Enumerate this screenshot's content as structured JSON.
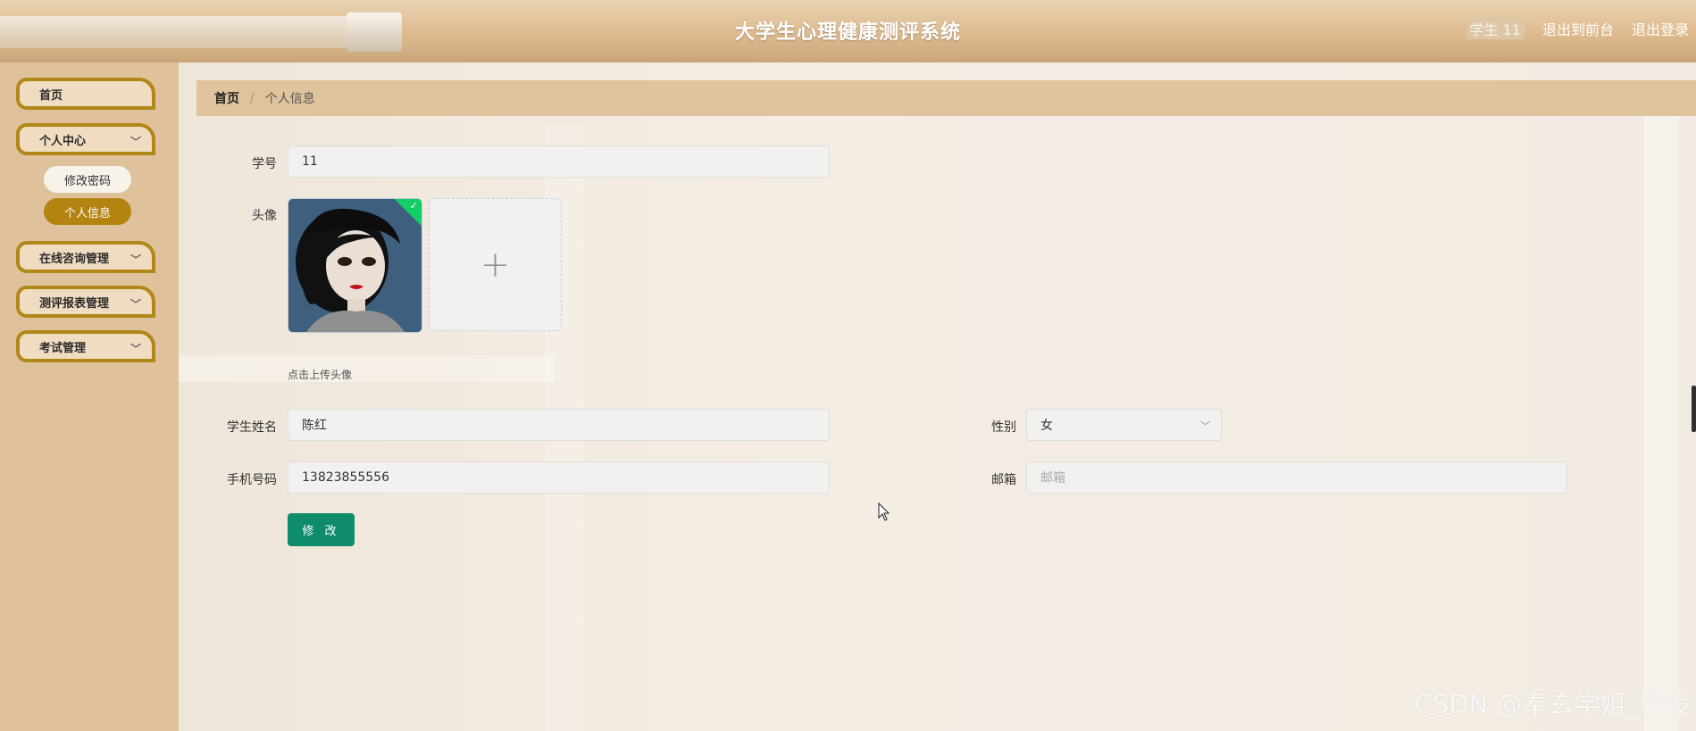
{
  "header": {
    "title": "大学生心理健康测评系统",
    "user": "学生 11",
    "to_front": "退出到前台",
    "logout": "退出登录"
  },
  "sidebar": {
    "items": [
      {
        "label": "首页",
        "has_arrow": false
      },
      {
        "label": "个人中心",
        "has_arrow": true
      },
      {
        "label": "在线咨询管理",
        "has_arrow": true
      },
      {
        "label": "测评报表管理",
        "has_arrow": true
      },
      {
        "label": "考试管理",
        "has_arrow": true
      }
    ],
    "submenu": [
      {
        "label": "修改密码",
        "active": false
      },
      {
        "label": "个人信息",
        "active": true
      }
    ]
  },
  "breadcrumb": {
    "home": "首页",
    "separator": "/",
    "current": "个人信息"
  },
  "form": {
    "student_id": {
      "label": "学号",
      "value": "11"
    },
    "avatar": {
      "label": "头像",
      "tip": "点击上传头像"
    },
    "name": {
      "label": "学生姓名",
      "value": "陈红"
    },
    "gender": {
      "label": "性别",
      "value": "女"
    },
    "phone": {
      "label": "手机号码",
      "value": "13823855556"
    },
    "email": {
      "label": "邮箱",
      "placeholder": "邮箱",
      "value": ""
    },
    "submit_label": "修 改"
  },
  "watermark": "CSDN @奉玄学姐_毕设",
  "colors": {
    "sidebar_border": "#b18717",
    "active_pill": "#b38410",
    "submit": "#0f8c6c",
    "breadcrumb_bg": "#dfc39c"
  }
}
